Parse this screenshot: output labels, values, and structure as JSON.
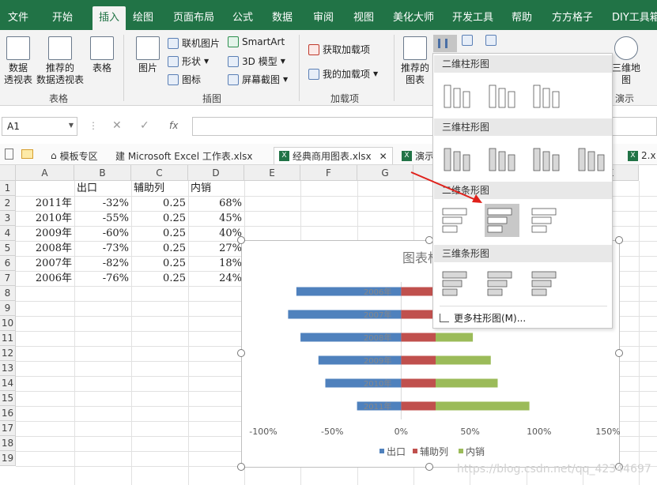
{
  "menu": {
    "tabs": [
      "文件",
      "开始",
      "插入",
      "绘图",
      "页面布局",
      "公式",
      "数据",
      "审阅",
      "视图",
      "美化大师",
      "开发工具",
      "帮助",
      "方方格子",
      "DIY工具箱"
    ],
    "active_tab": "插入"
  },
  "ribbon": {
    "tables_group": {
      "label": "表格",
      "pivot": "数据\n透视表",
      "recommended_pivot": "推荐的\n数据透视表",
      "table": "表格"
    },
    "illustrations_group": {
      "label": "插图",
      "pictures": "图片",
      "online_pictures": "联机图片",
      "shapes": "形状",
      "icons": "图标",
      "smartart": "SmartArt",
      "model3d": "3D 模型",
      "screenshot": "屏幕截图"
    },
    "addins_group": {
      "label": "加载项",
      "get_addins": "获取加载项",
      "my_addins": "我的加载项"
    },
    "charts_group": {
      "recommended_charts": "推荐的\n图表",
      "map3d": "三维地\n图",
      "tours_label": "演示"
    }
  },
  "formula_bar": {
    "name_box": "A1",
    "fx": "fx",
    "formula": ""
  },
  "workbook_tabs": [
    {
      "label": "模板专区"
    },
    {
      "label": "建 Microsoft Excel 工作表.xlsx"
    },
    {
      "label": "经典商用图表.xlsx",
      "active": true
    },
    {
      "label": "演示"
    },
    {
      "label": "2.x"
    }
  ],
  "sheet": {
    "columns": [
      "A",
      "B",
      "C",
      "D",
      "E",
      "F",
      "G",
      "H",
      "I",
      "J",
      "K"
    ],
    "rows": [
      "1",
      "2",
      "3",
      "4",
      "5",
      "6",
      "7",
      "8",
      "9",
      "10",
      "11",
      "12",
      "13",
      "14",
      "15",
      "16",
      "17",
      "18",
      "19"
    ],
    "header_row": [
      "",
      "出口",
      "辅助列",
      "内销"
    ],
    "data": [
      [
        "2011年",
        "-32%",
        "0.25",
        "68%"
      ],
      [
        "2010年",
        "-55%",
        "0.25",
        "45%"
      ],
      [
        "2009年",
        "-60%",
        "0.25",
        "40%"
      ],
      [
        "2008年",
        "-73%",
        "0.25",
        "27%"
      ],
      [
        "2007年",
        "-82%",
        "0.25",
        "18%"
      ],
      [
        "2006年",
        "-76%",
        "0.25",
        "24%"
      ]
    ]
  },
  "chart_data": {
    "type": "bar",
    "title": "图表标",
    "categories": [
      "2006年",
      "2007年",
      "2008年",
      "2009年",
      "2010年",
      "2011年"
    ],
    "series": [
      {
        "name": "出口",
        "values": [
          -0.76,
          -0.82,
          -0.73,
          -0.6,
          -0.55,
          -0.32
        ],
        "color": "#4f81bd"
      },
      {
        "name": "辅助列",
        "values": [
          0.25,
          0.25,
          0.25,
          0.25,
          0.25,
          0.25
        ],
        "color": "#c0504d"
      },
      {
        "name": "内销",
        "values": [
          0.24,
          0.18,
          0.27,
          0.4,
          0.45,
          0.68
        ],
        "color": "#9bbb59"
      }
    ],
    "stacked": true,
    "x_ticks": [
      "-100%",
      "-50%",
      "0%",
      "50%",
      "100%",
      "150%"
    ],
    "xlim": [
      -1.0,
      1.5
    ],
    "legend": "bottom"
  },
  "dropdown": {
    "sections": [
      "二维柱形图",
      "三维柱形图",
      "二维条形图",
      "三维条形图"
    ],
    "more": "更多柱形图(M)..."
  },
  "watermark": "https://blog.csdn.net/qq_42344697"
}
